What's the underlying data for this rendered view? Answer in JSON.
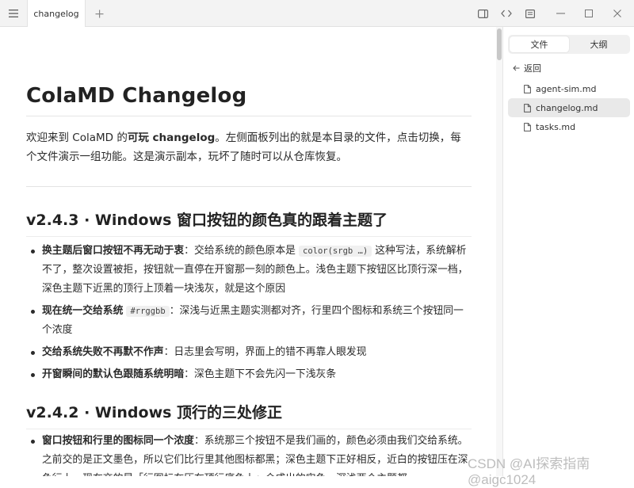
{
  "titlebar": {
    "tab_label": "changelog",
    "icons": [
      "hamburger-menu-icon",
      "plus-icon",
      "sidebar-toggle-icon",
      "code-view-icon",
      "outline-icon",
      "minimize-icon",
      "maximize-icon",
      "close-icon"
    ]
  },
  "document": {
    "title": "ColaMD Changelog",
    "intro_pre": "欢迎来到 ColaMD 的",
    "intro_strong": "可玩 changelog",
    "intro_post": "。左侧面板列出的就是本目录的文件，点击切换，每个文件演示一组功能。这是演示副本，玩坏了随时可以从仓库恢复。",
    "sections": [
      {
        "heading": "v2.4.3 · Windows 窗口按钮的颜色真的跟着主题了",
        "items": [
          {
            "bold": "换主题后窗口按钮不再无动于衷",
            "pre": "：交给系统的颜色原本是 ",
            "code": "color(srgb …)",
            "post": " 这种写法，系统解析不了，整次设置被拒，按钮就一直停在开窗那一刻的颜色上。浅色主题下按钮区比顶行深一档，深色主题下近黑的顶行上顶着一块浅灰，就是这个原因"
          },
          {
            "bold": "现在统一交给系统",
            "pre": " ",
            "code": "#rrggbb",
            "post": "：深浅与近黑主题实测都对齐，行里四个图标和系统三个按钮同一个浓度"
          },
          {
            "bold": "交给系统失败不再默不作声",
            "pre": "：日志里会写明，界面上的错不再靠人眼发现",
            "code": "",
            "post": ""
          },
          {
            "bold": "开窗瞬间的默认色跟随系统明暗",
            "pre": "：深色主题下不会先闪一下浅灰条",
            "code": "",
            "post": ""
          }
        ]
      },
      {
        "heading": "v2.4.2 · Windows 顶行的三处修正",
        "items": [
          {
            "bold": "窗口按钮和行里的图标同一个浓度",
            "pre": "：系统那三个按钮不是我们画的，颜色必须由我们交给系统。之前交的是正文墨色，所以它们比行里其他图标都黑；深色主题下正好相反，近白的按钮压在深色行上。现在交的是「行图标在压在顶行底色上」合成出的实色，深浅两个主题都",
            "code": "",
            "post": ""
          }
        ]
      }
    ]
  },
  "sidebar": {
    "tab_files": "文件",
    "tab_outline": "大纲",
    "back_label": "返回",
    "files": [
      {
        "name": "agent-sim.md",
        "active": false
      },
      {
        "name": "changelog.md",
        "active": true
      },
      {
        "name": "tasks.md",
        "active": false
      }
    ]
  },
  "watermark": "CSDN @AI探索指南 @aigc1024"
}
